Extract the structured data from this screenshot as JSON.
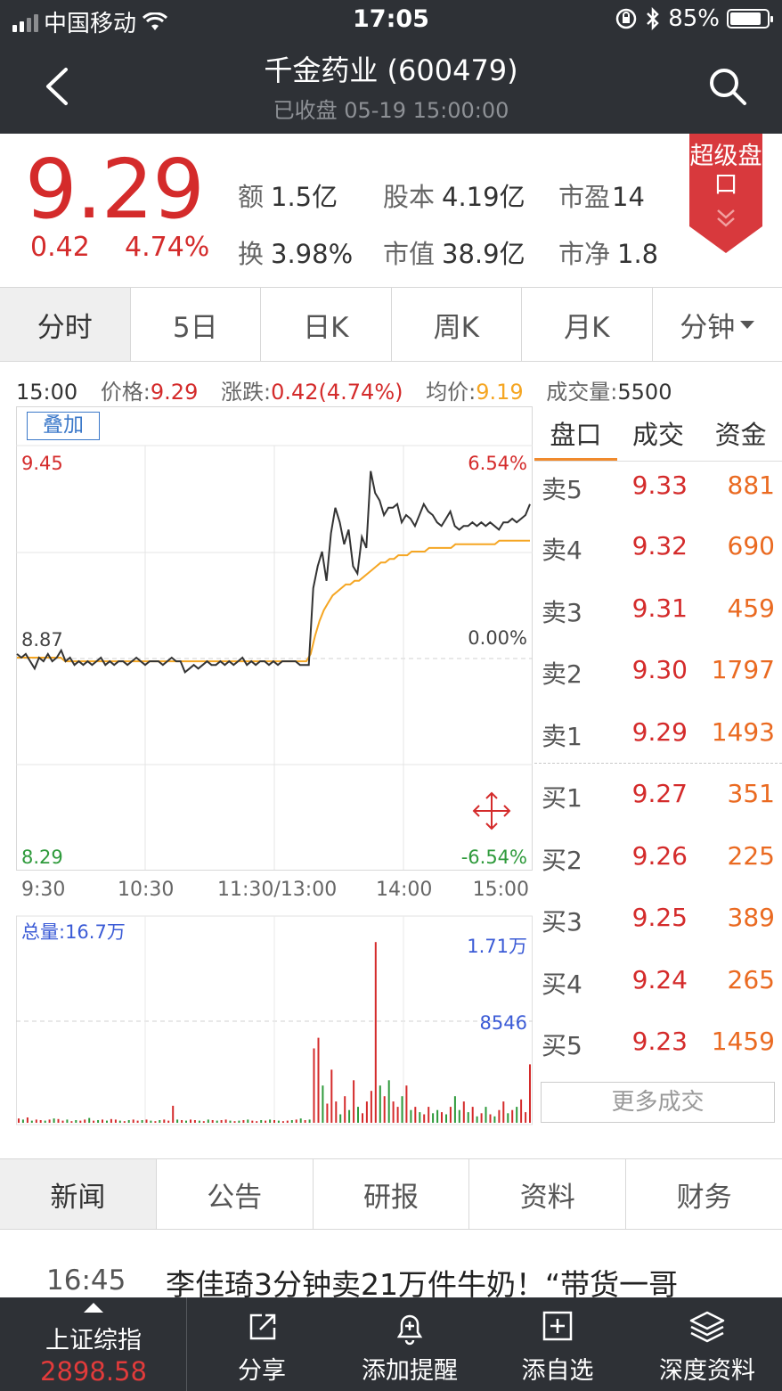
{
  "status_bar": {
    "carrier": "中国移动",
    "time": "17:05",
    "battery": "85%",
    "battery_level": 0.85
  },
  "header": {
    "title": "千金药业 (600479)",
    "subtitle": "已收盘 05-19 15:00:00"
  },
  "quote": {
    "price": "9.29",
    "change": "0.42",
    "change_pct": "4.74%",
    "stats": [
      {
        "k": "额",
        "v": "1.5亿"
      },
      {
        "k": "股本",
        "v": "4.19亿"
      },
      {
        "k": "市盈",
        "v": "14"
      },
      {
        "k": "换",
        "v": "3.98%"
      },
      {
        "k": "市值",
        "v": "38.9亿"
      },
      {
        "k": "市净",
        "v": "1.8"
      }
    ],
    "super_label": "超级盘口"
  },
  "chart_tabs": [
    "分时",
    "5日",
    "日K",
    "周K",
    "月K",
    "分钟"
  ],
  "info_line": {
    "time": "15:00",
    "price_label": "价格:",
    "price": "9.29",
    "chg_label": "涨跌:",
    "chg": "0.42(4.74%)",
    "avg_label": "均价:",
    "avg": "9.19",
    "vol_label": "成交量:",
    "vol": "5500"
  },
  "overlay_button": "叠加",
  "colors": {
    "up": "#d42b2b",
    "down": "#2e9a3b",
    "avg": "#f5a623",
    "price_line": "#333333",
    "accent": "#f08a2d"
  },
  "chart_data": {
    "type": "line",
    "price_axis": {
      "max": "9.45",
      "mid": "8.87",
      "min": "8.29",
      "ymin": 8.29,
      "ymax": 9.45
    },
    "pct_axis": {
      "max": "6.54%",
      "mid": "0.00%",
      "min": "-6.54%"
    },
    "x_ticks": [
      "9:30",
      "10:30",
      "11:30/13:00",
      "14:00",
      "15:00"
    ],
    "series": [
      {
        "values": [
          8.88,
          8.87,
          8.88,
          8.86,
          8.84,
          8.87,
          8.86,
          8.88,
          8.86,
          8.87,
          8.89,
          8.86,
          8.87,
          8.85,
          8.86,
          8.85,
          8.86,
          8.85,
          8.86,
          8.87,
          8.85,
          8.86,
          8.85,
          8.86,
          8.86,
          8.85,
          8.86,
          8.87,
          8.86,
          8.85,
          8.86,
          8.86,
          8.86,
          8.85,
          8.86,
          8.87,
          8.86,
          8.86,
          8.83,
          8.84,
          8.85,
          8.84,
          8.85,
          8.86,
          8.85,
          8.85,
          8.86,
          8.85,
          8.86,
          8.85,
          8.86,
          8.87,
          8.85,
          8.86,
          8.85,
          8.86,
          8.86,
          8.85,
          8.86,
          8.85,
          8.86,
          8.86,
          8.86,
          8.86,
          8.85,
          8.85,
          8.85,
          9.06,
          9.12,
          9.16,
          9.08,
          9.21,
          9.28,
          9.24,
          9.18,
          9.22,
          9.12,
          9.1,
          9.2,
          9.17,
          9.38,
          9.32,
          9.3,
          9.26,
          9.28,
          9.28,
          9.29,
          9.24,
          9.26,
          9.25,
          9.23,
          9.26,
          9.29,
          9.27,
          9.26,
          9.24,
          9.23,
          9.25,
          9.27,
          9.23,
          9.22,
          9.23,
          9.23,
          9.24,
          9.23,
          9.24,
          9.23,
          9.24,
          9.23,
          9.22,
          9.24,
          9.24,
          9.25,
          9.24,
          9.25,
          9.26,
          9.29
        ]
      },
      {
        "values": [
          8.87,
          8.87,
          8.87,
          8.87,
          8.87,
          8.87,
          8.87,
          8.87,
          8.87,
          8.87,
          8.87,
          8.86,
          8.86,
          8.86,
          8.86,
          8.86,
          8.86,
          8.86,
          8.86,
          8.86,
          8.86,
          8.86,
          8.86,
          8.86,
          8.86,
          8.86,
          8.86,
          8.86,
          8.86,
          8.86,
          8.86,
          8.86,
          8.86,
          8.86,
          8.86,
          8.86,
          8.86,
          8.86,
          8.86,
          8.86,
          8.86,
          8.86,
          8.86,
          8.86,
          8.86,
          8.86,
          8.86,
          8.86,
          8.86,
          8.86,
          8.86,
          8.86,
          8.86,
          8.86,
          8.86,
          8.86,
          8.86,
          8.86,
          8.86,
          8.86,
          8.86,
          8.86,
          8.86,
          8.86,
          8.86,
          8.86,
          8.86,
          8.88,
          8.93,
          8.97,
          9.0,
          9.02,
          9.04,
          9.05,
          9.06,
          9.07,
          9.07,
          9.08,
          9.08,
          9.09,
          9.1,
          9.11,
          9.12,
          9.13,
          9.13,
          9.14,
          9.14,
          9.15,
          9.15,
          9.15,
          9.16,
          9.16,
          9.16,
          9.16,
          9.17,
          9.17,
          9.17,
          9.17,
          9.17,
          9.17,
          9.18,
          9.18,
          9.18,
          9.18,
          9.18,
          9.18,
          9.18,
          9.18,
          9.18,
          9.18,
          9.19,
          9.19,
          9.19,
          9.19,
          9.19,
          9.19,
          9.19,
          9.19
        ]
      }
    ],
    "volume": {
      "total_label": "总量:16.7万",
      "max_label": "1.71万",
      "mid_label": "8546",
      "vmax": 17100,
      "values": [
        400,
        300,
        500,
        200,
        300,
        250,
        200,
        300,
        400,
        350,
        200,
        300,
        150,
        250,
        200,
        300,
        450,
        200,
        250,
        300,
        200,
        350,
        300,
        200,
        150,
        250,
        300,
        200,
        250,
        300,
        200,
        150,
        250,
        300,
        200,
        1600,
        300,
        250,
        200,
        300,
        250,
        200,
        150,
        300,
        250,
        200,
        250,
        300,
        200,
        150,
        200,
        250,
        300,
        200,
        150,
        250,
        200,
        300,
        250,
        200,
        150,
        200,
        250,
        300,
        400,
        250,
        300,
        7000,
        8000,
        3500,
        1800,
        5000,
        2000,
        800,
        2500,
        1200,
        4000,
        1500,
        900,
        2000,
        3000,
        17000,
        3500,
        2500,
        4000,
        2000,
        1500,
        2500,
        3500,
        1200,
        1500,
        1000,
        800,
        1500,
        900,
        1200,
        1000,
        800,
        1500,
        2500,
        1200,
        2000,
        1000,
        1500,
        600,
        900,
        1500,
        800,
        600,
        1200,
        2000,
        900,
        1200,
        1500,
        2200,
        1000,
        5500
      ],
      "up": [
        1,
        0,
        1,
        0,
        1,
        1,
        0,
        1,
        0,
        1,
        1,
        0,
        1,
        0,
        1,
        1,
        0,
        1,
        0,
        1,
        0,
        1,
        1,
        0,
        1,
        0,
        1,
        1,
        0,
        1,
        0,
        1,
        0,
        1,
        1,
        1,
        0,
        1,
        0,
        1,
        1,
        0,
        1,
        0,
        1,
        0,
        1,
        1,
        0,
        1,
        0,
        1,
        0,
        1,
        1,
        0,
        1,
        0,
        1,
        0,
        1,
        1,
        0,
        1,
        0,
        1,
        0,
        1,
        1,
        0,
        1,
        1,
        1,
        0,
        1,
        0,
        1,
        0,
        1,
        1,
        1,
        1,
        0,
        1,
        0,
        1,
        1,
        0,
        1,
        0,
        1,
        0,
        1,
        1,
        0,
        0,
        1,
        0,
        1,
        0,
        0,
        1,
        0,
        1,
        0,
        1,
        0,
        1,
        0,
        1,
        1,
        0,
        1,
        0,
        1,
        1,
        1
      ]
    }
  },
  "order_book": {
    "tabs": [
      "盘口",
      "成交",
      "资金"
    ],
    "asks": [
      {
        "label": "卖5",
        "price": "9.33",
        "vol": "881"
      },
      {
        "label": "卖4",
        "price": "9.32",
        "vol": "690"
      },
      {
        "label": "卖3",
        "price": "9.31",
        "vol": "459"
      },
      {
        "label": "卖2",
        "price": "9.30",
        "vol": "1797"
      },
      {
        "label": "卖1",
        "price": "9.29",
        "vol": "1493"
      }
    ],
    "bids": [
      {
        "label": "买1",
        "price": "9.27",
        "vol": "351"
      },
      {
        "label": "买2",
        "price": "9.26",
        "vol": "225"
      },
      {
        "label": "买3",
        "price": "9.25",
        "vol": "389"
      },
      {
        "label": "买4",
        "price": "9.24",
        "vol": "265"
      },
      {
        "label": "买5",
        "price": "9.23",
        "vol": "1459"
      }
    ],
    "more_label": "更多成交"
  },
  "news_tabs": [
    "新闻",
    "公告",
    "研报",
    "资料",
    "财务"
  ],
  "news": {
    "time": "16:45",
    "headline": "李佳琦3分钟卖21万件牛奶！“带货一哥"
  },
  "bottom_bar": {
    "index_name": "上证综指",
    "index_value": "2898.58",
    "items": [
      {
        "label": "分享",
        "icon": "share-icon"
      },
      {
        "label": "添加提醒",
        "icon": "bell-plus-icon"
      },
      {
        "label": "添自选",
        "icon": "add-square-icon"
      },
      {
        "label": "深度资料",
        "icon": "layers-icon"
      }
    ]
  }
}
